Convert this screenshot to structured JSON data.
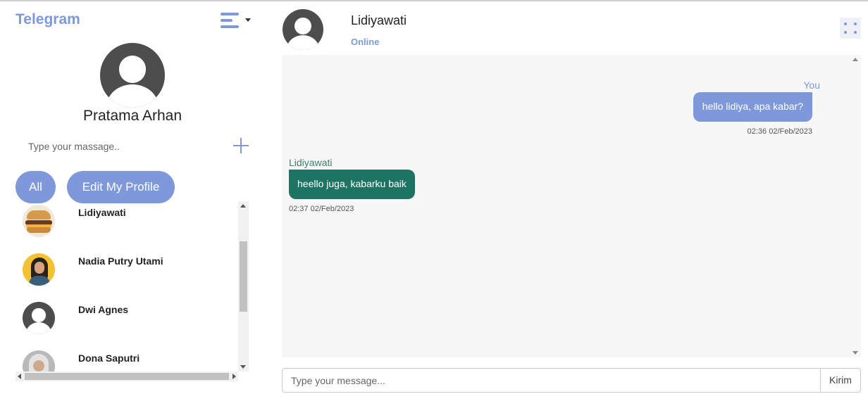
{
  "app": {
    "title": "Telegram"
  },
  "sidebar": {
    "menu_icon": "hamburger-menu-icon",
    "profile": {
      "name": "Pratama Arhan",
      "avatar": "default-user-avatar"
    },
    "search": {
      "placeholder": "Type your massage..",
      "value": ""
    },
    "add_icon": "plus-icon",
    "filters": [
      {
        "label": "All"
      },
      {
        "label": "Edit My Profile"
      }
    ],
    "contacts": [
      {
        "name": "Lidiyawati",
        "avatar": "burger-photo"
      },
      {
        "name": "Nadia Putry Utami",
        "avatar": "woman-photo-yellow"
      },
      {
        "name": "Dwi Agnes",
        "avatar": "default-user-avatar"
      },
      {
        "name": "Dona Saputri",
        "avatar": "woman-photo-grey"
      }
    ]
  },
  "chat": {
    "header": {
      "name": "Lidiyawati",
      "status": "Online",
      "menu_icon": "dots-grid-icon"
    },
    "messages": [
      {
        "sender": "You",
        "text": "hello lidiya, apa kabar?",
        "time": "02:36 02/Feb/2023",
        "side": "right"
      },
      {
        "sender": "Lidiyawati",
        "text": "heello juga, kabarku baik",
        "time": "02:37 02/Feb/2023",
        "side": "left"
      }
    ],
    "input": {
      "placeholder": "Type your message...",
      "value": ""
    },
    "send_label": "Kirim"
  },
  "colors": {
    "accent": "#7e98d9",
    "incoming_bubble": "#1e7462",
    "chat_background": "#f7f7f7"
  }
}
